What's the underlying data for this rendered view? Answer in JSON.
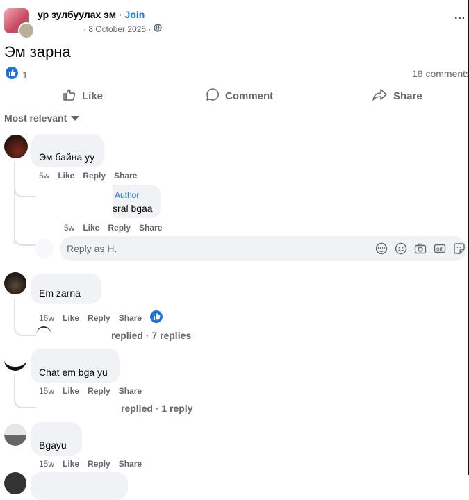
{
  "post": {
    "group_name": "ур зулбуулах эм",
    "join_label": "Join",
    "dot": "·",
    "date": "· 8 October 2025 ·",
    "more": "···",
    "text": "Эм зарна",
    "reactions_count": "1",
    "comments_count": "18 comments"
  },
  "actions": {
    "like": "Like",
    "comment": "Comment",
    "share": "Share"
  },
  "sort": {
    "label": "Most relevant"
  },
  "comments": [
    {
      "text": "Эм байна уу",
      "time": "5w",
      "like": "Like",
      "reply": "Reply",
      "share": "Share"
    },
    {
      "text": "Em zarna",
      "time": "16w",
      "like": "Like",
      "reply": "Reply",
      "share": "Share",
      "replies": "replied · 7 replies"
    },
    {
      "text": "Chat em bga yu",
      "time": "15w",
      "like": "Like",
      "reply": "Reply",
      "share": "Share",
      "replies": "replied · 1 reply"
    },
    {
      "text": "Bgayu",
      "time": "15w",
      "like": "Like",
      "reply": "Reply",
      "share": "Share"
    }
  ],
  "author_reply": {
    "badge": "Author",
    "text": "sral bgaa",
    "time": "5w",
    "like": "Like",
    "reply": "Reply",
    "share": "Share"
  },
  "reply_box": {
    "placeholder": "Reply as H."
  },
  "colors": {
    "accent": "#1b74e4",
    "bubble": "#f0f2f5",
    "muted": "#65676b"
  }
}
